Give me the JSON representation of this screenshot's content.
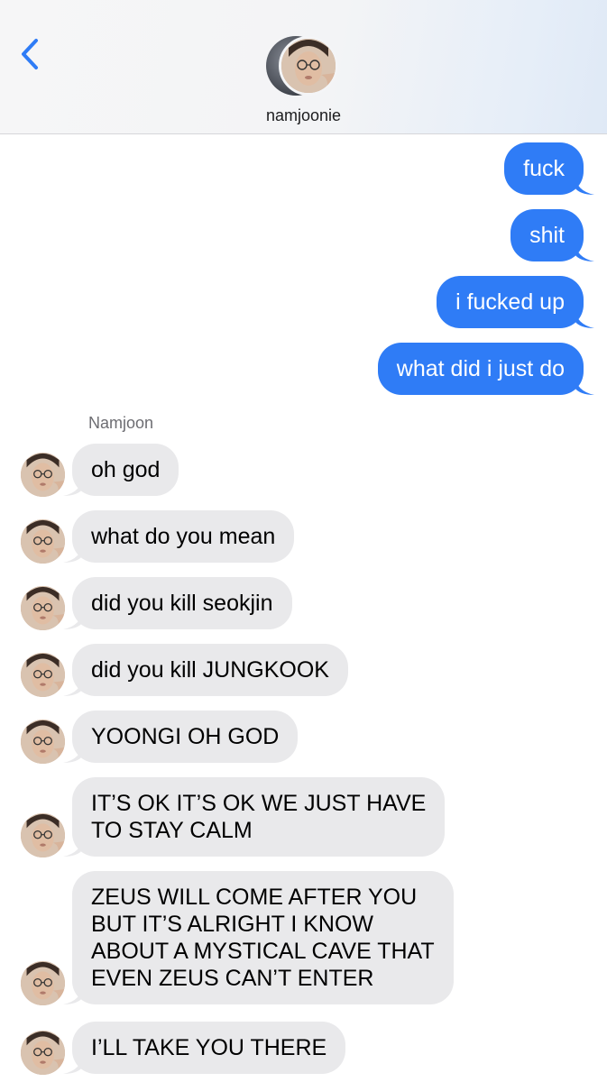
{
  "header": {
    "contact_name": "namjoonie"
  },
  "outgoing": [
    {
      "text": "fuck"
    },
    {
      "text": "shit"
    },
    {
      "text": "i fucked up"
    },
    {
      "text": "what did i just do"
    }
  ],
  "incoming": {
    "sender": "Namjoon",
    "messages": [
      {
        "lines": [
          "oh god"
        ]
      },
      {
        "lines": [
          "what do you mean"
        ]
      },
      {
        "lines": [
          "did you kill seokjin"
        ]
      },
      {
        "lines": [
          "did you kill JUNGKOOK"
        ]
      },
      {
        "lines": [
          "YOONGI OH GOD"
        ]
      },
      {
        "lines": [
          "IT’S OK IT’S OK WE JUST HAVE",
          "TO STAY CALM"
        ]
      },
      {
        "lines": [
          "ZEUS WILL COME AFTER YOU",
          "BUT IT’S ALRIGHT I KNOW",
          "ABOUT A MYSTICAL CAVE THAT",
          "EVEN ZEUS CAN’T ENTER"
        ]
      },
      {
        "lines": [
          "I’LL TAKE YOU THERE"
        ]
      }
    ]
  },
  "colors": {
    "outgoing_bubble": "#2f7cf6",
    "incoming_bubble": "#e9e9eb",
    "back_chevron": "#2f7cf6"
  },
  "icons": {
    "back": "chevron-left-icon",
    "avatar": "contact-avatar",
    "sender_avatar": "sender-avatar"
  }
}
